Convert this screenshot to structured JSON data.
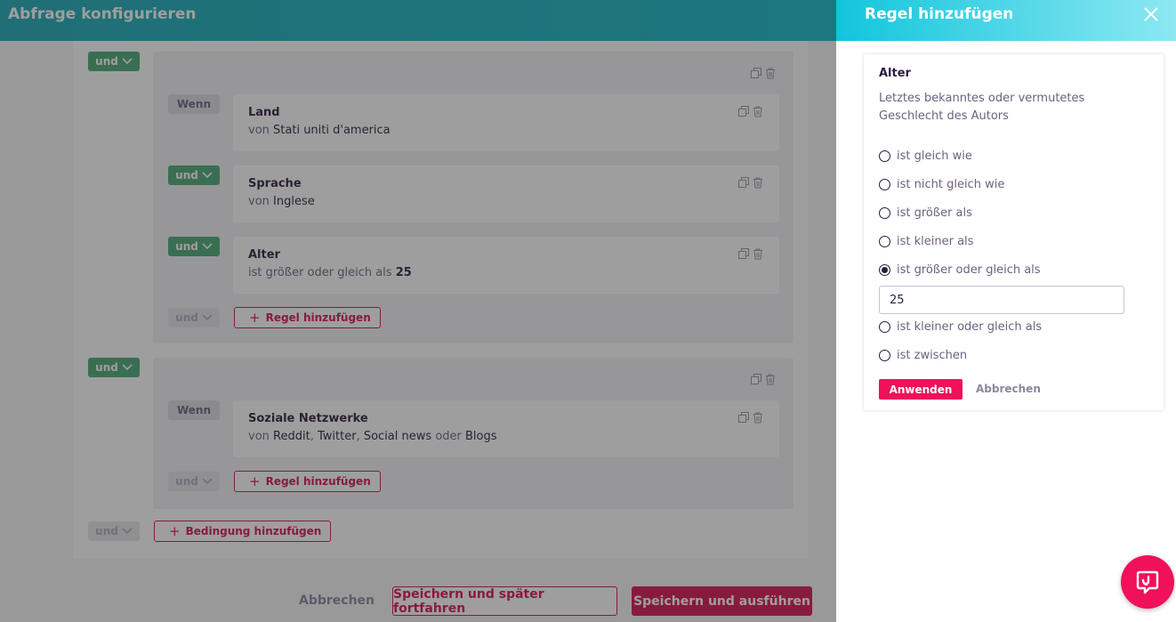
{
  "header": {
    "title": "Abfrage konfigurieren"
  },
  "groups": [
    {
      "connector": "und",
      "rules": [
        {
          "prefix": "Wenn",
          "title": "Land",
          "sub_prefix": "von",
          "value": "Stati uniti d'america"
        },
        {
          "prefix": "und",
          "title": "Sprache",
          "sub_prefix": "von",
          "value": "Inglese"
        },
        {
          "prefix": "und",
          "title": "Alter",
          "sub_prefix": "ist größer oder gleich als",
          "value": "25"
        }
      ],
      "footer_connector": "und",
      "add_rule_label": "Regel hinzufügen"
    },
    {
      "connector": "und",
      "rules": [
        {
          "prefix": "Wenn",
          "title": "Soziale Netzwerke",
          "sub_prefix": "von",
          "v1": "Reddit",
          "sep1": ",",
          "v2": "Twitter",
          "sep2": ",",
          "v3": "Social news",
          "sep3": "oder",
          "v4": "Blogs"
        }
      ],
      "footer_connector": "und",
      "add_rule_label": "Regel hinzufügen"
    }
  ],
  "bottom": {
    "connector": "und",
    "add_condition_label": "Bedingung hinzufügen"
  },
  "footer": {
    "cancel": "Abbrechen",
    "save_later": "Speichern und später fortfahren",
    "save_run": "Speichern und ausführen"
  },
  "panel": {
    "title": "Regel hinzufügen",
    "close_icon": "close-icon",
    "rule_title": "Alter",
    "description": "Letztes bekanntes oder vermutetes Geschlecht des Autors",
    "options": [
      {
        "label": "ist gleich wie",
        "checked": false
      },
      {
        "label": "ist nicht gleich wie",
        "checked": false
      },
      {
        "label": "ist größer als",
        "checked": false
      },
      {
        "label": "ist kleiner als",
        "checked": false
      },
      {
        "label": "ist größer oder gleich als",
        "checked": true
      },
      {
        "label": "ist kleiner oder gleich als",
        "checked": false
      },
      {
        "label": "ist zwischen",
        "checked": false
      }
    ],
    "input_value": "25",
    "apply": "Anwenden",
    "cancel": "Abbrechen"
  },
  "colors": {
    "accent": "#d6124f",
    "green": "#4aa876",
    "header": "#1aa9b7"
  }
}
